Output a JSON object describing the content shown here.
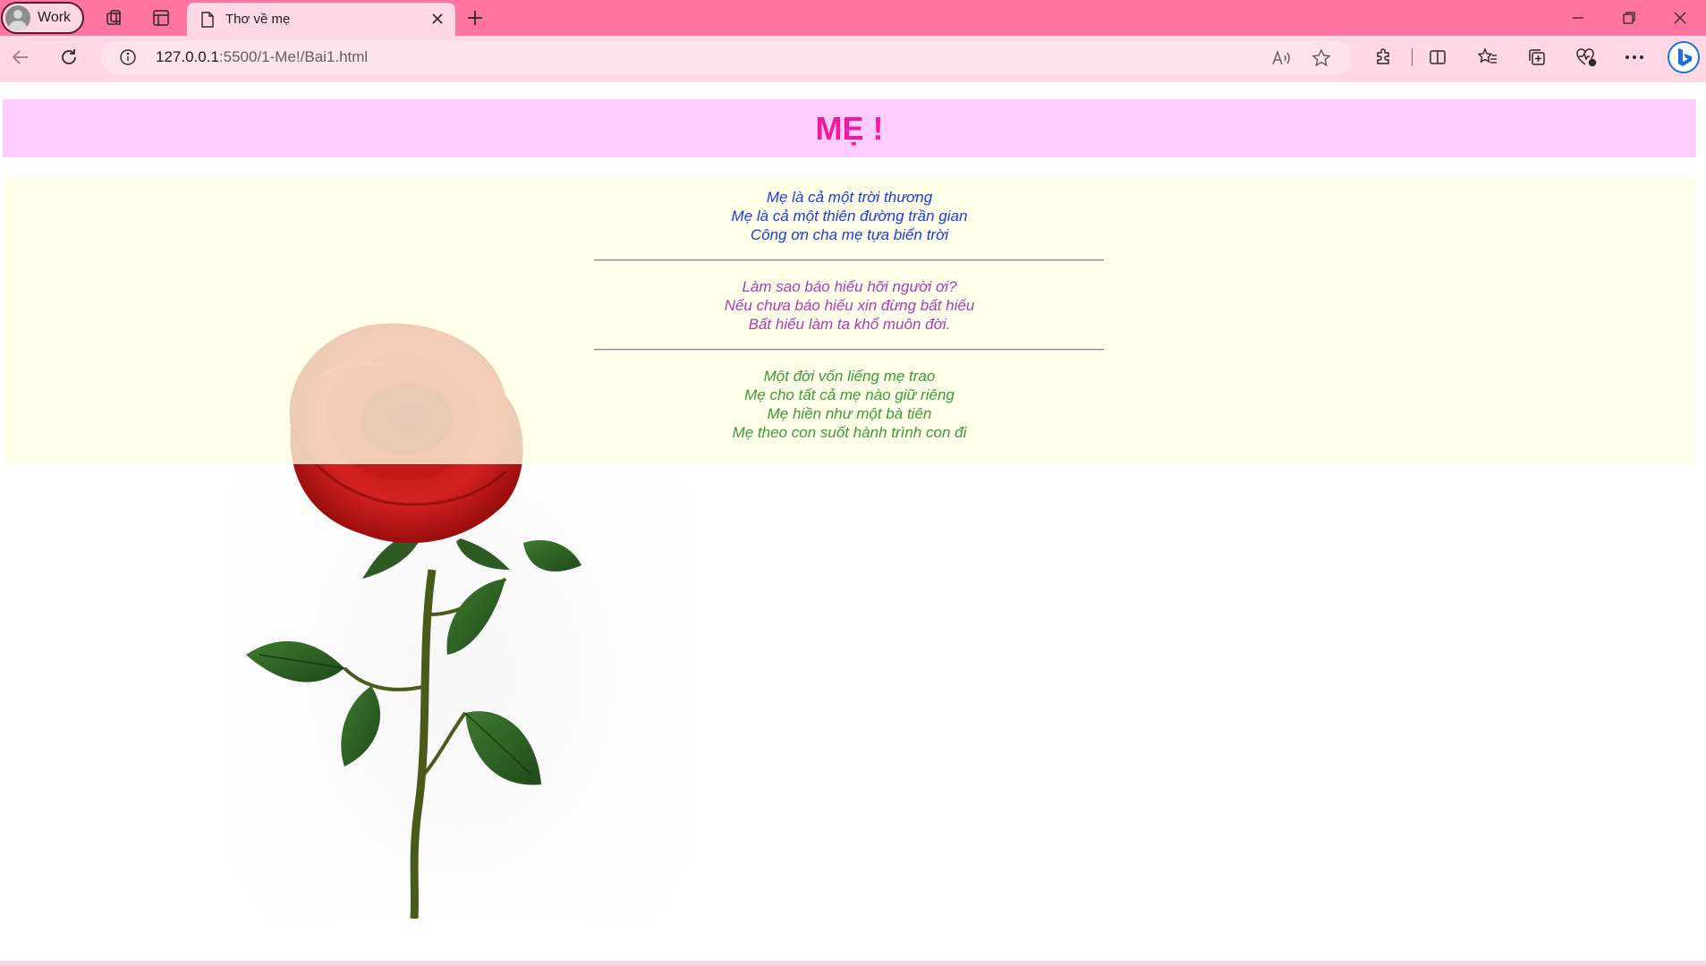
{
  "browser": {
    "profile_label": "Work",
    "tab_title": "Thơ về mẹ",
    "url_host": "127.0.0.1",
    "url_path": ":5500/1-Me!/Bai1.html"
  },
  "page": {
    "heading": "MẸ !",
    "stanzas": [
      {
        "color": "#1b3ce0",
        "lines": [
          "Mẹ là cả một trời thương",
          "Mẹ là cả một thiên đường trần gian",
          "Công ơn cha mẹ tựa biển trời"
        ]
      },
      {
        "color": "#b03ab8",
        "lines": [
          "Làm sao báo hiếu hỡi người ơi?",
          "Nếu chưa báo hiếu xin đừng bất hiếu",
          "Bất hiếu làm ta khổ muôn đời."
        ]
      },
      {
        "color": "#3a9a3a",
        "lines": [
          "Một đời vốn liếng mẹ trao",
          "Mẹ cho tất cả mẹ nào giữ riêng",
          "Mẹ hiền như một bà tiên",
          "Mẹ theo con suốt hành trình con đi"
        ]
      }
    ],
    "heading_color": "#ef1ba0",
    "header_bg": "#ffccff",
    "poem_bg": "#ffffe4"
  }
}
